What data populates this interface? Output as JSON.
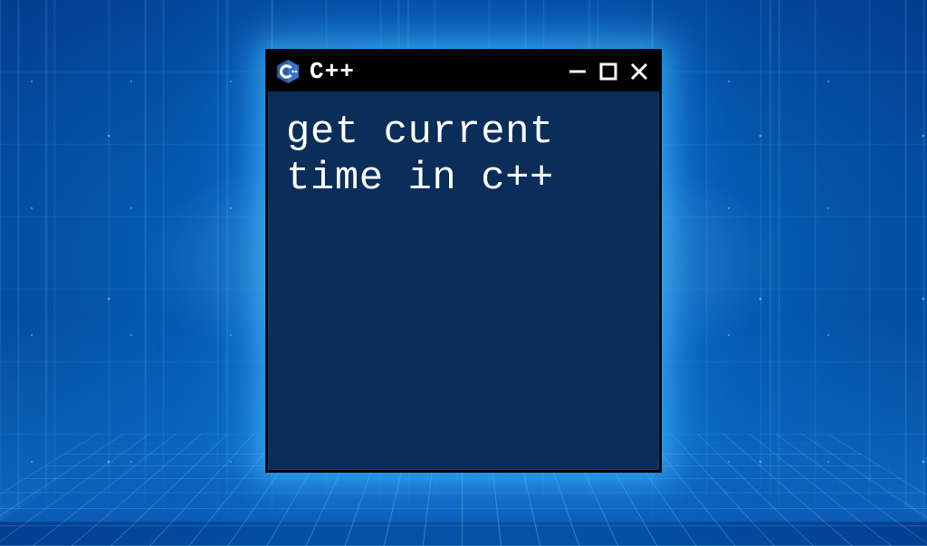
{
  "window": {
    "title": "C++",
    "icon_name": "cpp-hex-icon"
  },
  "content": {
    "text": "get current time in c++"
  }
}
